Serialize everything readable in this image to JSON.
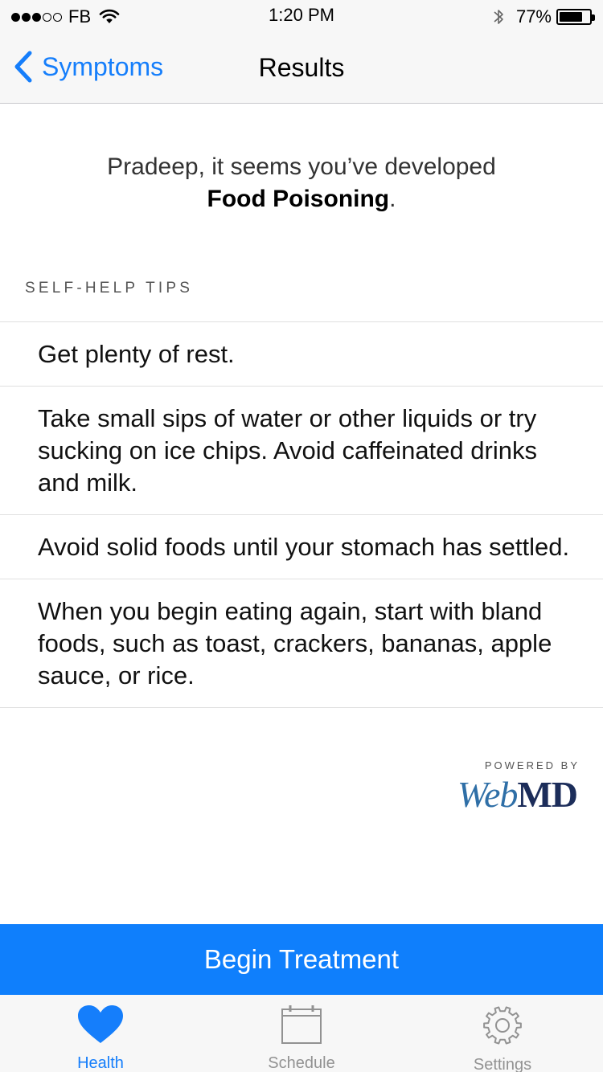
{
  "status_bar": {
    "carrier": "FB",
    "time": "1:20 PM",
    "battery_percent": "77%",
    "battery_level": 0.77,
    "signal_strength": 3,
    "signal_max": 5
  },
  "nav": {
    "back_label": "Symptoms",
    "back_icon": "chevron-left-icon",
    "title": "Results"
  },
  "diagnosis": {
    "line1": "Pradeep, it seems you’ve developed",
    "condition": "Food Poisoning",
    "punctuation": "."
  },
  "section": {
    "header": "SELF-HELP TIPS"
  },
  "tips": [
    "Get plenty of rest.",
    "Take small sips of water or other liquids or try sucking on ice chips. Avoid caffeinated drinks and milk.",
    "Avoid solid foods until your stomach has settled.",
    "When you begin eating again, start with bland foods, such as toast, crackers, bananas, apple sauce, or rice."
  ],
  "powered_by": {
    "label": "POWERED BY",
    "logo_web": "Web",
    "logo_md": "MD"
  },
  "cta": {
    "label": "Begin Treatment"
  },
  "tab_bar": {
    "tabs": [
      {
        "label": "Health",
        "icon": "heart-icon",
        "active": true
      },
      {
        "label": "Schedule",
        "icon": "calendar-icon",
        "active": false
      },
      {
        "label": "Settings",
        "icon": "gear-icon",
        "active": false
      }
    ]
  },
  "colors": {
    "accent": "#157efb",
    "cta_background": "#0f7ffc",
    "inactive_tab": "#929292"
  }
}
